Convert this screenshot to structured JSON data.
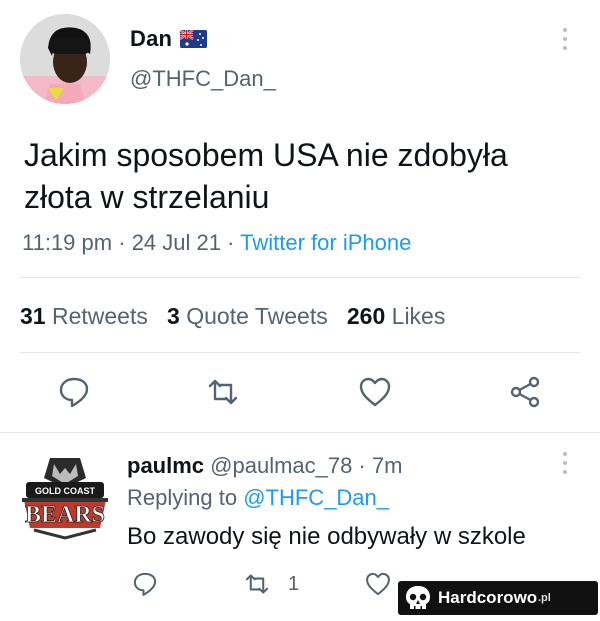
{
  "author": {
    "name": "Dan",
    "flag": "australia-flag",
    "handle": "@THFC_Dan_"
  },
  "tweet": {
    "text": "Jakim sposobem USA nie zdobyła złota w strzelaniu",
    "time": "11:19 pm",
    "sep1": "·",
    "date": "24 Jul 21",
    "sep2": "·",
    "source": "Twitter for iPhone"
  },
  "stats": {
    "retweets_count": "31",
    "retweets_label": "Retweets",
    "quotes_count": "3",
    "quotes_label": "Quote Tweets",
    "likes_count": "260",
    "likes_label": "Likes"
  },
  "actions": [
    "reply-icon",
    "retweet-icon",
    "like-icon",
    "share-icon"
  ],
  "reply": {
    "name": "paulmc",
    "handle": "@paulmac_78",
    "sep": "·",
    "age": "7m",
    "replying_prefix": "Replying to",
    "replying_to": "@THFC_Dan_",
    "text": "Bo zawody się nie odbywały w szkole",
    "retweet_count": "1",
    "avatar_text_top": "GOLD COAST",
    "avatar_text_main": "BEARS"
  },
  "watermark": {
    "text": "Hardcorowo",
    "suffix": ".pl"
  },
  "colors": {
    "accent": "#1d9bf0",
    "text": "#0f1419",
    "muted": "#536471",
    "divider": "#e1e6ea"
  }
}
